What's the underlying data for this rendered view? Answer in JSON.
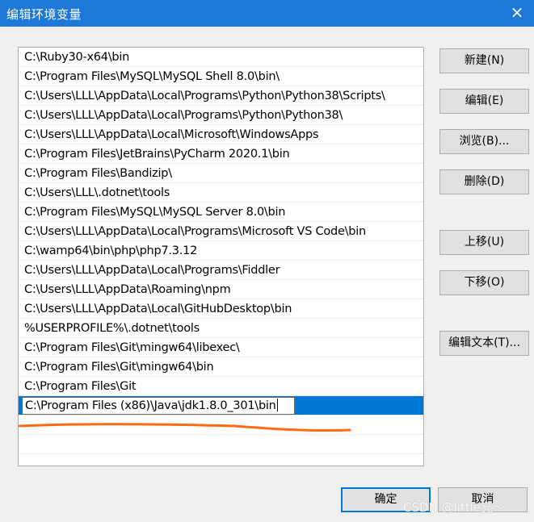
{
  "window": {
    "title": "编辑环境变量",
    "close_label": "×"
  },
  "paths": [
    "C:\\Ruby30-x64\\bin",
    "C:\\Program Files\\MySQL\\MySQL Shell 8.0\\bin\\",
    "C:\\Users\\LLL\\AppData\\Local\\Programs\\Python\\Python38\\Scripts\\",
    "C:\\Users\\LLL\\AppData\\Local\\Programs\\Python\\Python38\\",
    "C:\\Users\\LLL\\AppData\\Local\\Microsoft\\WindowsApps",
    "C:\\Program Files\\JetBrains\\PyCharm 2020.1\\bin",
    "C:\\Program Files\\Bandizip\\",
    "C:\\Users\\LLL\\.dotnet\\tools",
    "C:\\Program Files\\MySQL\\MySQL Server 8.0\\bin",
    "C:\\Users\\LLL\\AppData\\Local\\Programs\\Microsoft VS Code\\bin",
    "C:\\wamp64\\bin\\php\\php7.3.12",
    "C:\\Users\\LLL\\AppData\\Local\\Programs\\Fiddler",
    "C:\\Users\\LLL\\AppData\\Roaming\\npm",
    "C:\\Users\\LLL\\AppData\\Local\\GitHubDesktop\\bin",
    "%USERPROFILE%\\.dotnet\\tools",
    "C:\\Program Files\\Git\\mingw64\\libexec\\",
    "C:\\Program Files\\Git\\mingw64\\bin",
    "C:\\Program Files\\Git"
  ],
  "editing_value": "C:\\Program Files (x86)\\Java\\jdk1.8.0_301\\bin",
  "buttons": {
    "new": "新建(N)",
    "edit": "编辑(E)",
    "browse": "浏览(B)...",
    "delete": "删除(D)",
    "move_up": "上移(U)",
    "move_down": "下移(O)",
    "edit_text": "编辑文本(T)...",
    "ok": "确定",
    "cancel": "取消"
  },
  "watermark": "CSDN @little亮～",
  "colors": {
    "titlebar": "#1e78d7",
    "selection": "#0078d7",
    "annotation_underline": "#ff6a13"
  }
}
